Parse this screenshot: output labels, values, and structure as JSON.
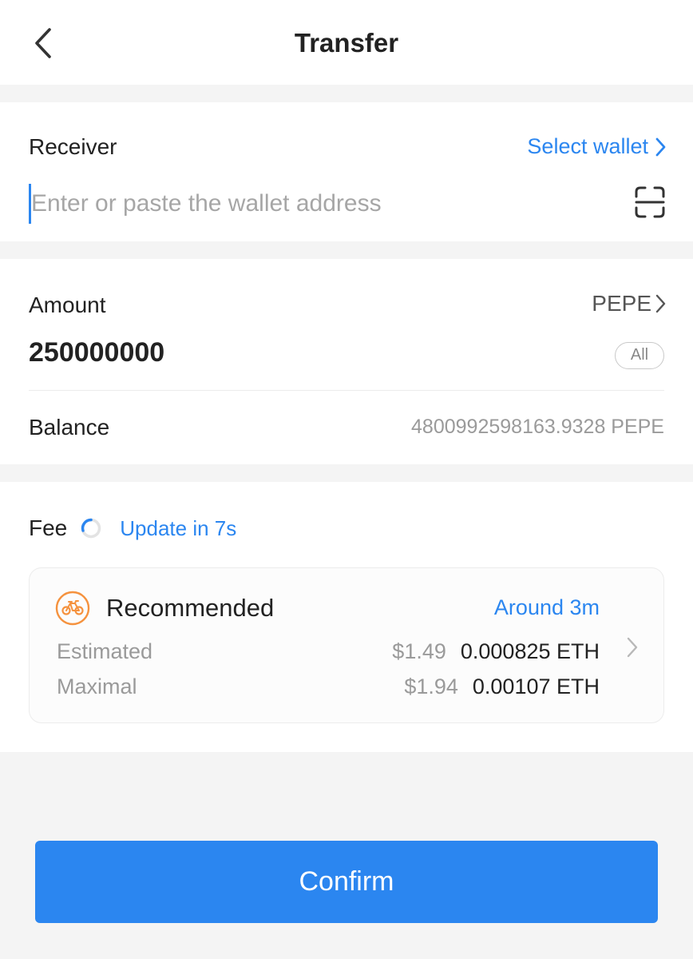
{
  "header": {
    "title": "Transfer"
  },
  "receiver": {
    "label": "Receiver",
    "select_wallet": "Select wallet",
    "address_placeholder": "Enter or paste the wallet address",
    "address_value": ""
  },
  "amount": {
    "label": "Amount",
    "token": "PEPE",
    "value": "250000000",
    "all_label": "All",
    "balance_label": "Balance",
    "balance_value": "4800992598163.9328 PEPE"
  },
  "fee": {
    "label": "Fee",
    "update_text": "Update in 7s",
    "tier": {
      "name": "Recommended",
      "time": "Around 3m",
      "estimated_label": "Estimated",
      "estimated_usd": "$1.49",
      "estimated_eth": "0.000825 ETH",
      "maximal_label": "Maximal",
      "maximal_usd": "$1.94",
      "maximal_eth": "0.00107 ETH"
    }
  },
  "confirm_label": "Confirm",
  "colors": {
    "accent": "#2b86f0",
    "recommended_icon": "#f5923e",
    "page_background": "#f4f4f4"
  },
  "icons": {
    "back": "chevron-left-icon",
    "select_wallet": "chevron-right-icon",
    "scan": "scan-icon",
    "token": "chevron-right-icon",
    "loading": "spinner-icon",
    "recommended": "bicycle-icon",
    "fee_detail": "chevron-right-icon"
  }
}
